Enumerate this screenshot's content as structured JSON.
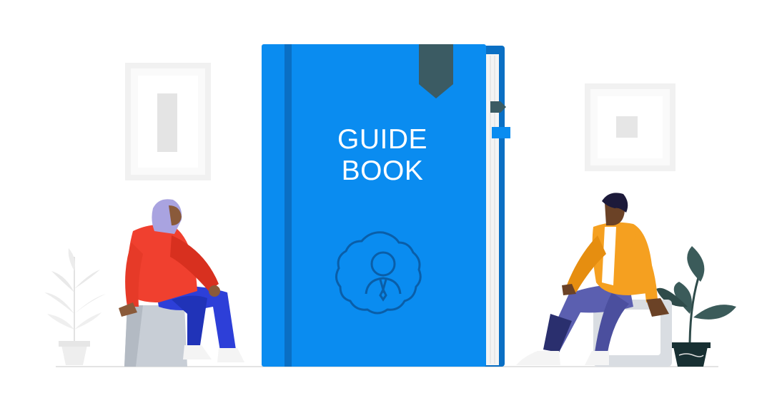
{
  "book": {
    "title_line1": "GUIDE",
    "title_line2": "BOOK",
    "cover_color": "#0a8cf0",
    "spine_color": "#0a6fc4",
    "bookmark_color": "#3b5b63",
    "emblem_icon": "person-badge-icon"
  },
  "people": {
    "left": {
      "jacket_color": "#f0402f",
      "pants_color": "#2d3fd8",
      "headscarf_color": "#a9a3e0"
    },
    "right": {
      "jacket_color": "#f5a020",
      "pants_color": "#5b5fb0"
    }
  },
  "decor": {
    "left_frame_icon": "picture-frame-icon",
    "right_frame_icon": "picture-frame-icon",
    "left_plant_icon": "potted-plant-icon",
    "right_plant_icon": "potted-plant-icon"
  }
}
